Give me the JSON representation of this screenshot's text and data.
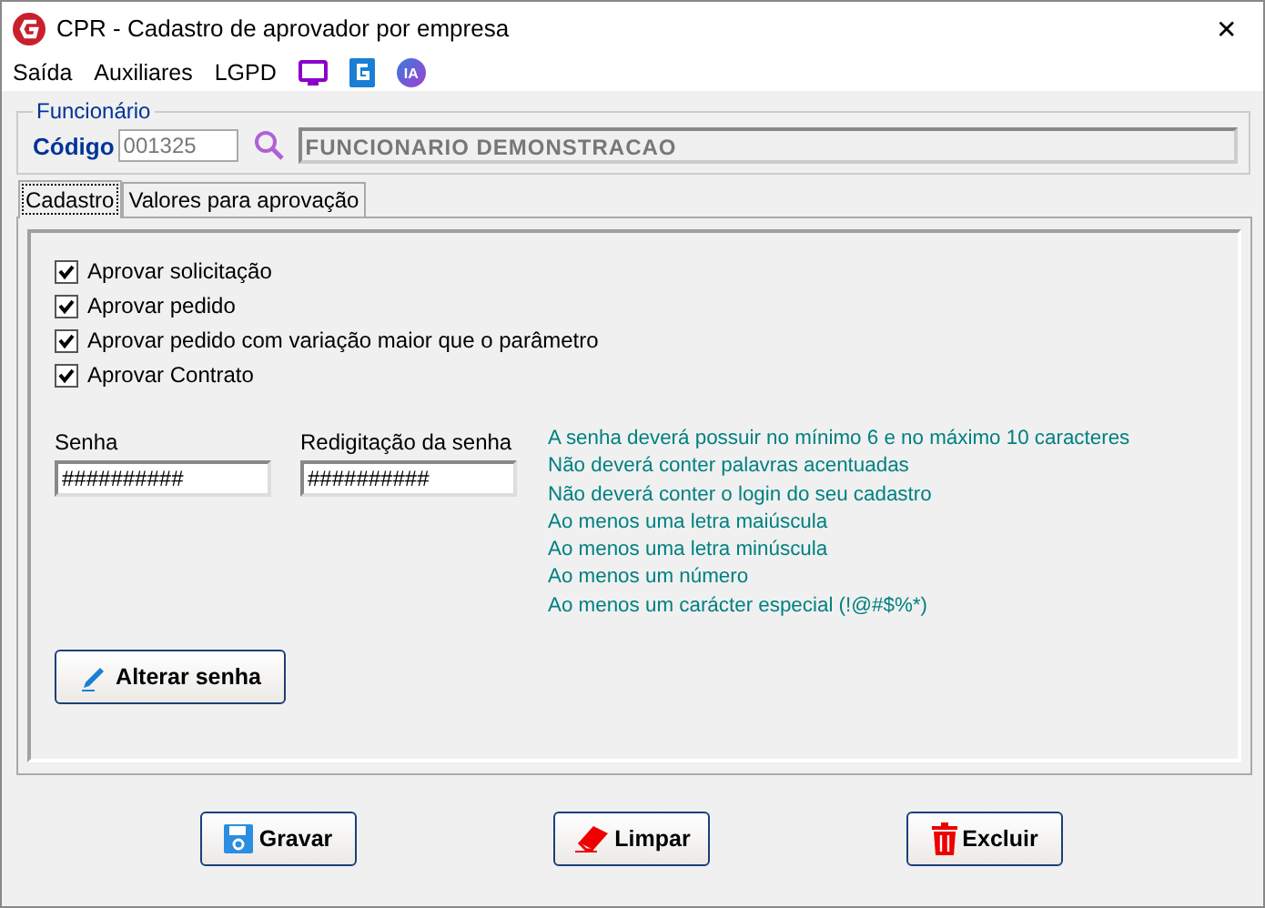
{
  "window": {
    "title": "CPR - Cadastro de aprovador por empresa",
    "close": "✕"
  },
  "menu": [
    {
      "kind": "text",
      "label": "Saída"
    },
    {
      "kind": "text",
      "label": "Auxiliares"
    },
    {
      "kind": "text",
      "label": "LGPD"
    },
    {
      "kind": "monitor"
    },
    {
      "kind": "g"
    },
    {
      "kind": "ia",
      "label": "IA"
    }
  ],
  "employee": {
    "legend": "Funcionário",
    "code_label": "Código",
    "code": "001325",
    "name": "FUNCIONARIO DEMONSTRACAO"
  },
  "tabs": [
    {
      "label": "Cadastro",
      "selected": true
    },
    {
      "label": "Valores para aprovação",
      "selected": false
    }
  ],
  "checks": [
    {
      "label": "Aprovar solicitação",
      "checked": true
    },
    {
      "label": "Aprovar pedido",
      "checked": true
    },
    {
      "label": "Aprovar pedido com variação maior que o parâmetro",
      "checked": true
    },
    {
      "label": "Aprovar Contrato",
      "checked": true
    }
  ],
  "password": {
    "label": "Senha",
    "value": "##########"
  },
  "password_confirm": {
    "label": "Redigitação da senha",
    "value": "##########"
  },
  "rules": [
    "A senha deverá possuir no mínimo 6 e no máximo 10 caracteres",
    "Não deverá conter palavras acentuadas",
    "Não deverá conter o login do seu cadastro",
    "Ao menos uma letra maiúscula",
    "Ao menos uma letra minúscula",
    "Ao menos um número",
    "Ao menos um carácter especial (!@#$%*)"
  ],
  "change_password": "Alterar senha",
  "buttons": [
    {
      "kind": "save",
      "label": "Gravar"
    },
    {
      "kind": "clear",
      "label": "Limpar"
    },
    {
      "kind": "delete",
      "label": "Excluir"
    }
  ]
}
